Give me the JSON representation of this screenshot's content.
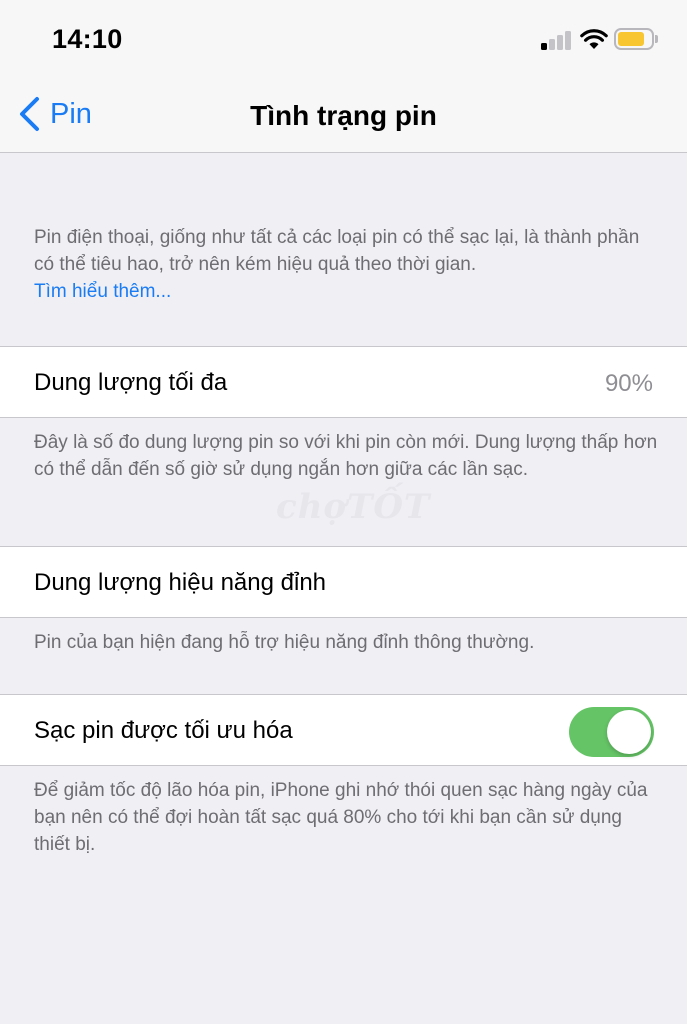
{
  "status_bar": {
    "time": "14:10",
    "signal_bars_active": 1,
    "signal_bars_total": 4,
    "battery_level": 0.8,
    "battery_color": "#f7c631"
  },
  "nav": {
    "back_label": "Pin",
    "title": "Tình trạng pin"
  },
  "intro": {
    "text": "Pin điện thoại, giống như tất cả các loại pin có thể sạc lại, là thành phần có thể tiêu hao, trở nên kém hiệu quả theo thời gian.",
    "learn_more": "Tìm hiểu thêm..."
  },
  "max_capacity": {
    "label": "Dung lượng tối đa",
    "value": "90%",
    "footnote": "Đây là số đo dung lượng pin so với khi pin còn mới. Dung lượng thấp hơn có thể dẫn đến số giờ sử dụng ngắn hơn giữa các lần sạc."
  },
  "peak_performance": {
    "label": "Dung lượng hiệu năng đỉnh",
    "footnote": "Pin của bạn hiện đang hỗ trợ hiệu năng đỉnh thông thường."
  },
  "optimized_charging": {
    "label": "Sạc pin được tối ưu hóa",
    "enabled": true,
    "footnote": "Để giảm tốc độ lão hóa pin, iPhone ghi nhớ thói quen sạc hàng ngày của bạn nên có thể đợi hoàn tất sạc quá 80% cho tới khi bạn cần sử dụng thiết bị."
  },
  "watermark": "chợTỐT",
  "colors": {
    "accent": "#1a7cf5",
    "toggle_on": "#65c466",
    "background": "#efeff4"
  }
}
